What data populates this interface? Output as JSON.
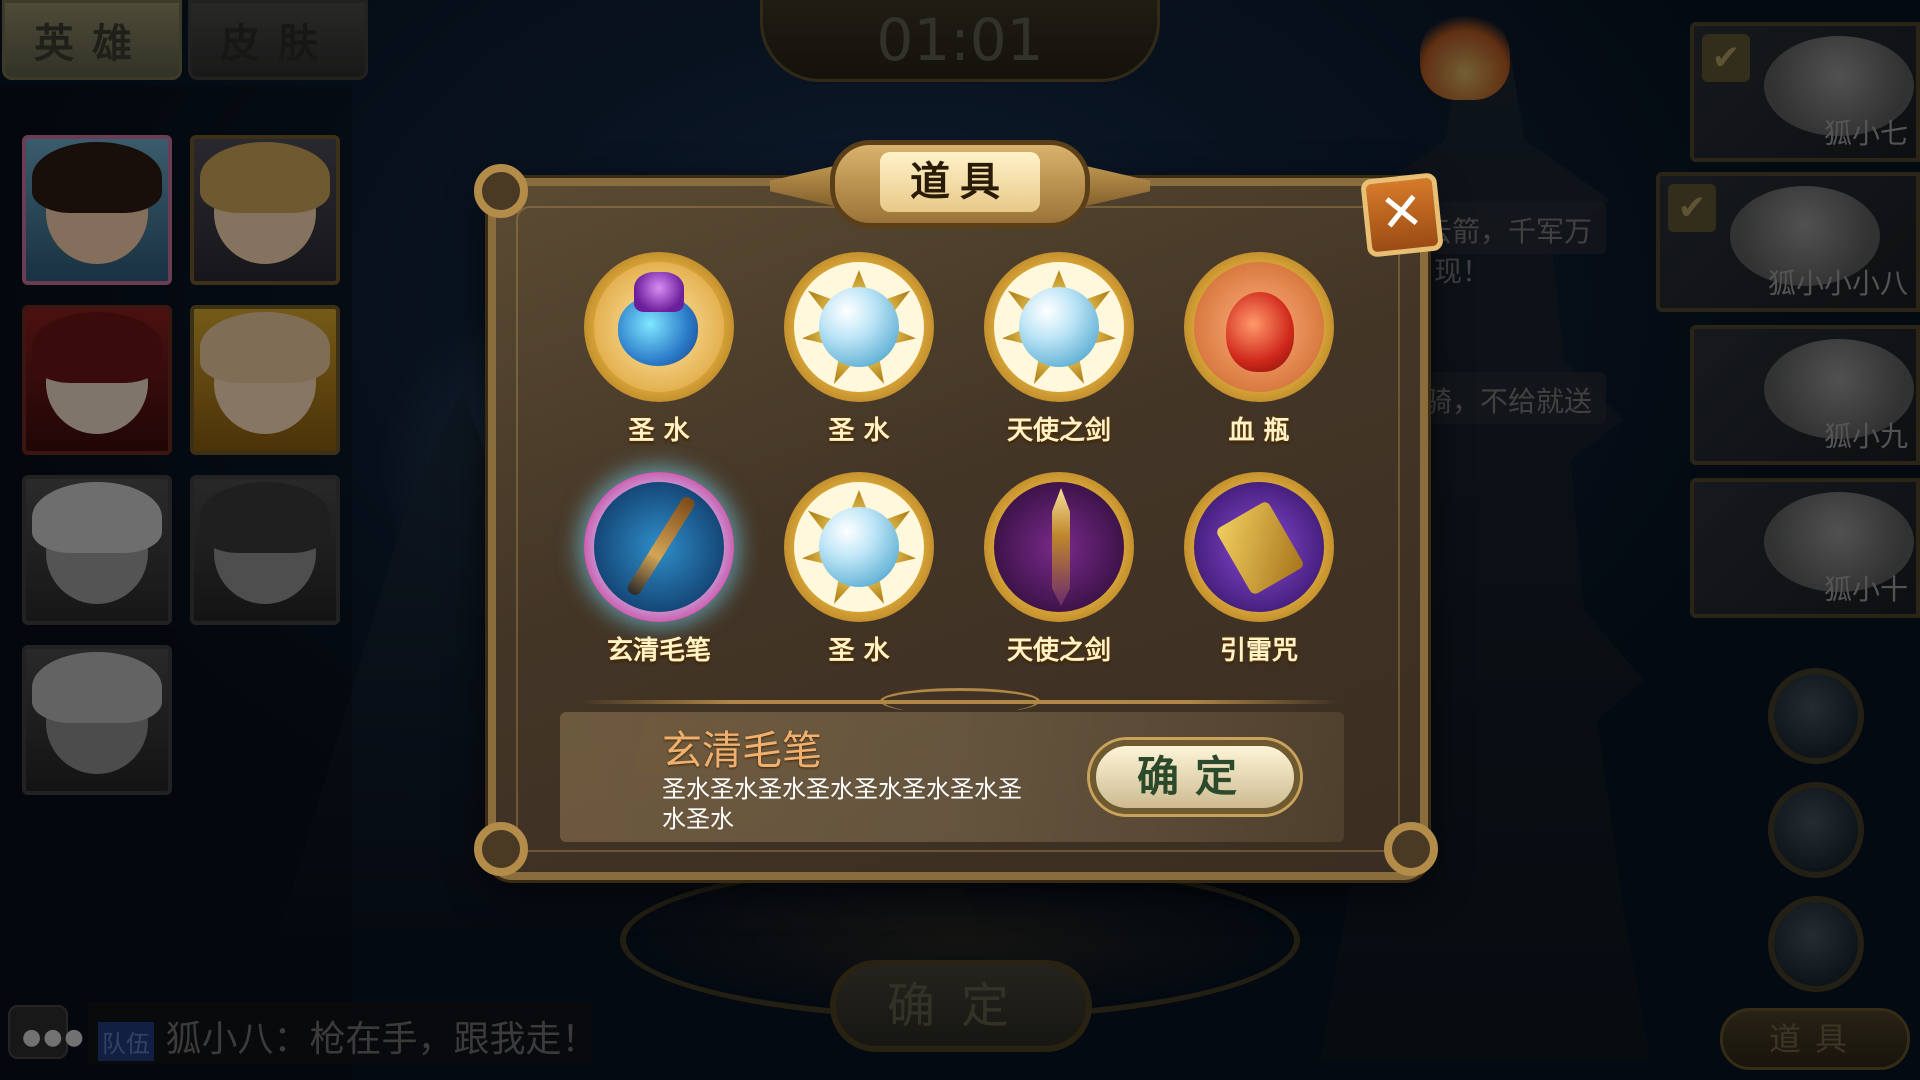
{
  "tabs": {
    "hero": "英雄",
    "skin": "皮肤"
  },
  "timer": "01:01",
  "modal": {
    "title": "道具",
    "close_label": "✕",
    "items": [
      {
        "label": "圣  水",
        "icon": "holy-water-vase-icon"
      },
      {
        "label": "圣  水",
        "icon": "pearl-mirror-icon"
      },
      {
        "label": "天使之剑",
        "icon": "pearl-mirror-icon"
      },
      {
        "label": "血  瓶",
        "icon": "blood-gourd-icon"
      },
      {
        "label": "玄清毛笔",
        "icon": "lightning-brush-icon"
      },
      {
        "label": "圣  水",
        "icon": "pearl-mirror-icon"
      },
      {
        "label": "天使之剑",
        "icon": "flaming-sword-icon"
      },
      {
        "label": "引雷咒",
        "icon": "thunder-scroll-icon"
      }
    ],
    "selected_index": 4,
    "detail": {
      "name": "玄清毛笔",
      "description": "圣水圣水圣水圣水圣水圣水圣水圣水圣水"
    },
    "confirm_label": "确定"
  },
  "players": [
    {
      "name": "狐小七",
      "checked": true
    },
    {
      "name": "狐小小小八",
      "checked": true
    },
    {
      "name": "狐小九",
      "checked": false
    },
    {
      "name": "狐小十",
      "checked": false
    }
  ],
  "bubbles": [
    "云箭，千军万",
    "现！",
    "骑，不给就送"
  ],
  "side_tool_label": "道具",
  "bg_confirm_label": "确定",
  "chat": {
    "tag": "队伍",
    "message": "狐小八：枪在手，跟我走！"
  },
  "colors": {
    "accent_gold": "#e0ad3c",
    "title_orange": "#f0b070",
    "close_orange": "#d67a2a"
  }
}
